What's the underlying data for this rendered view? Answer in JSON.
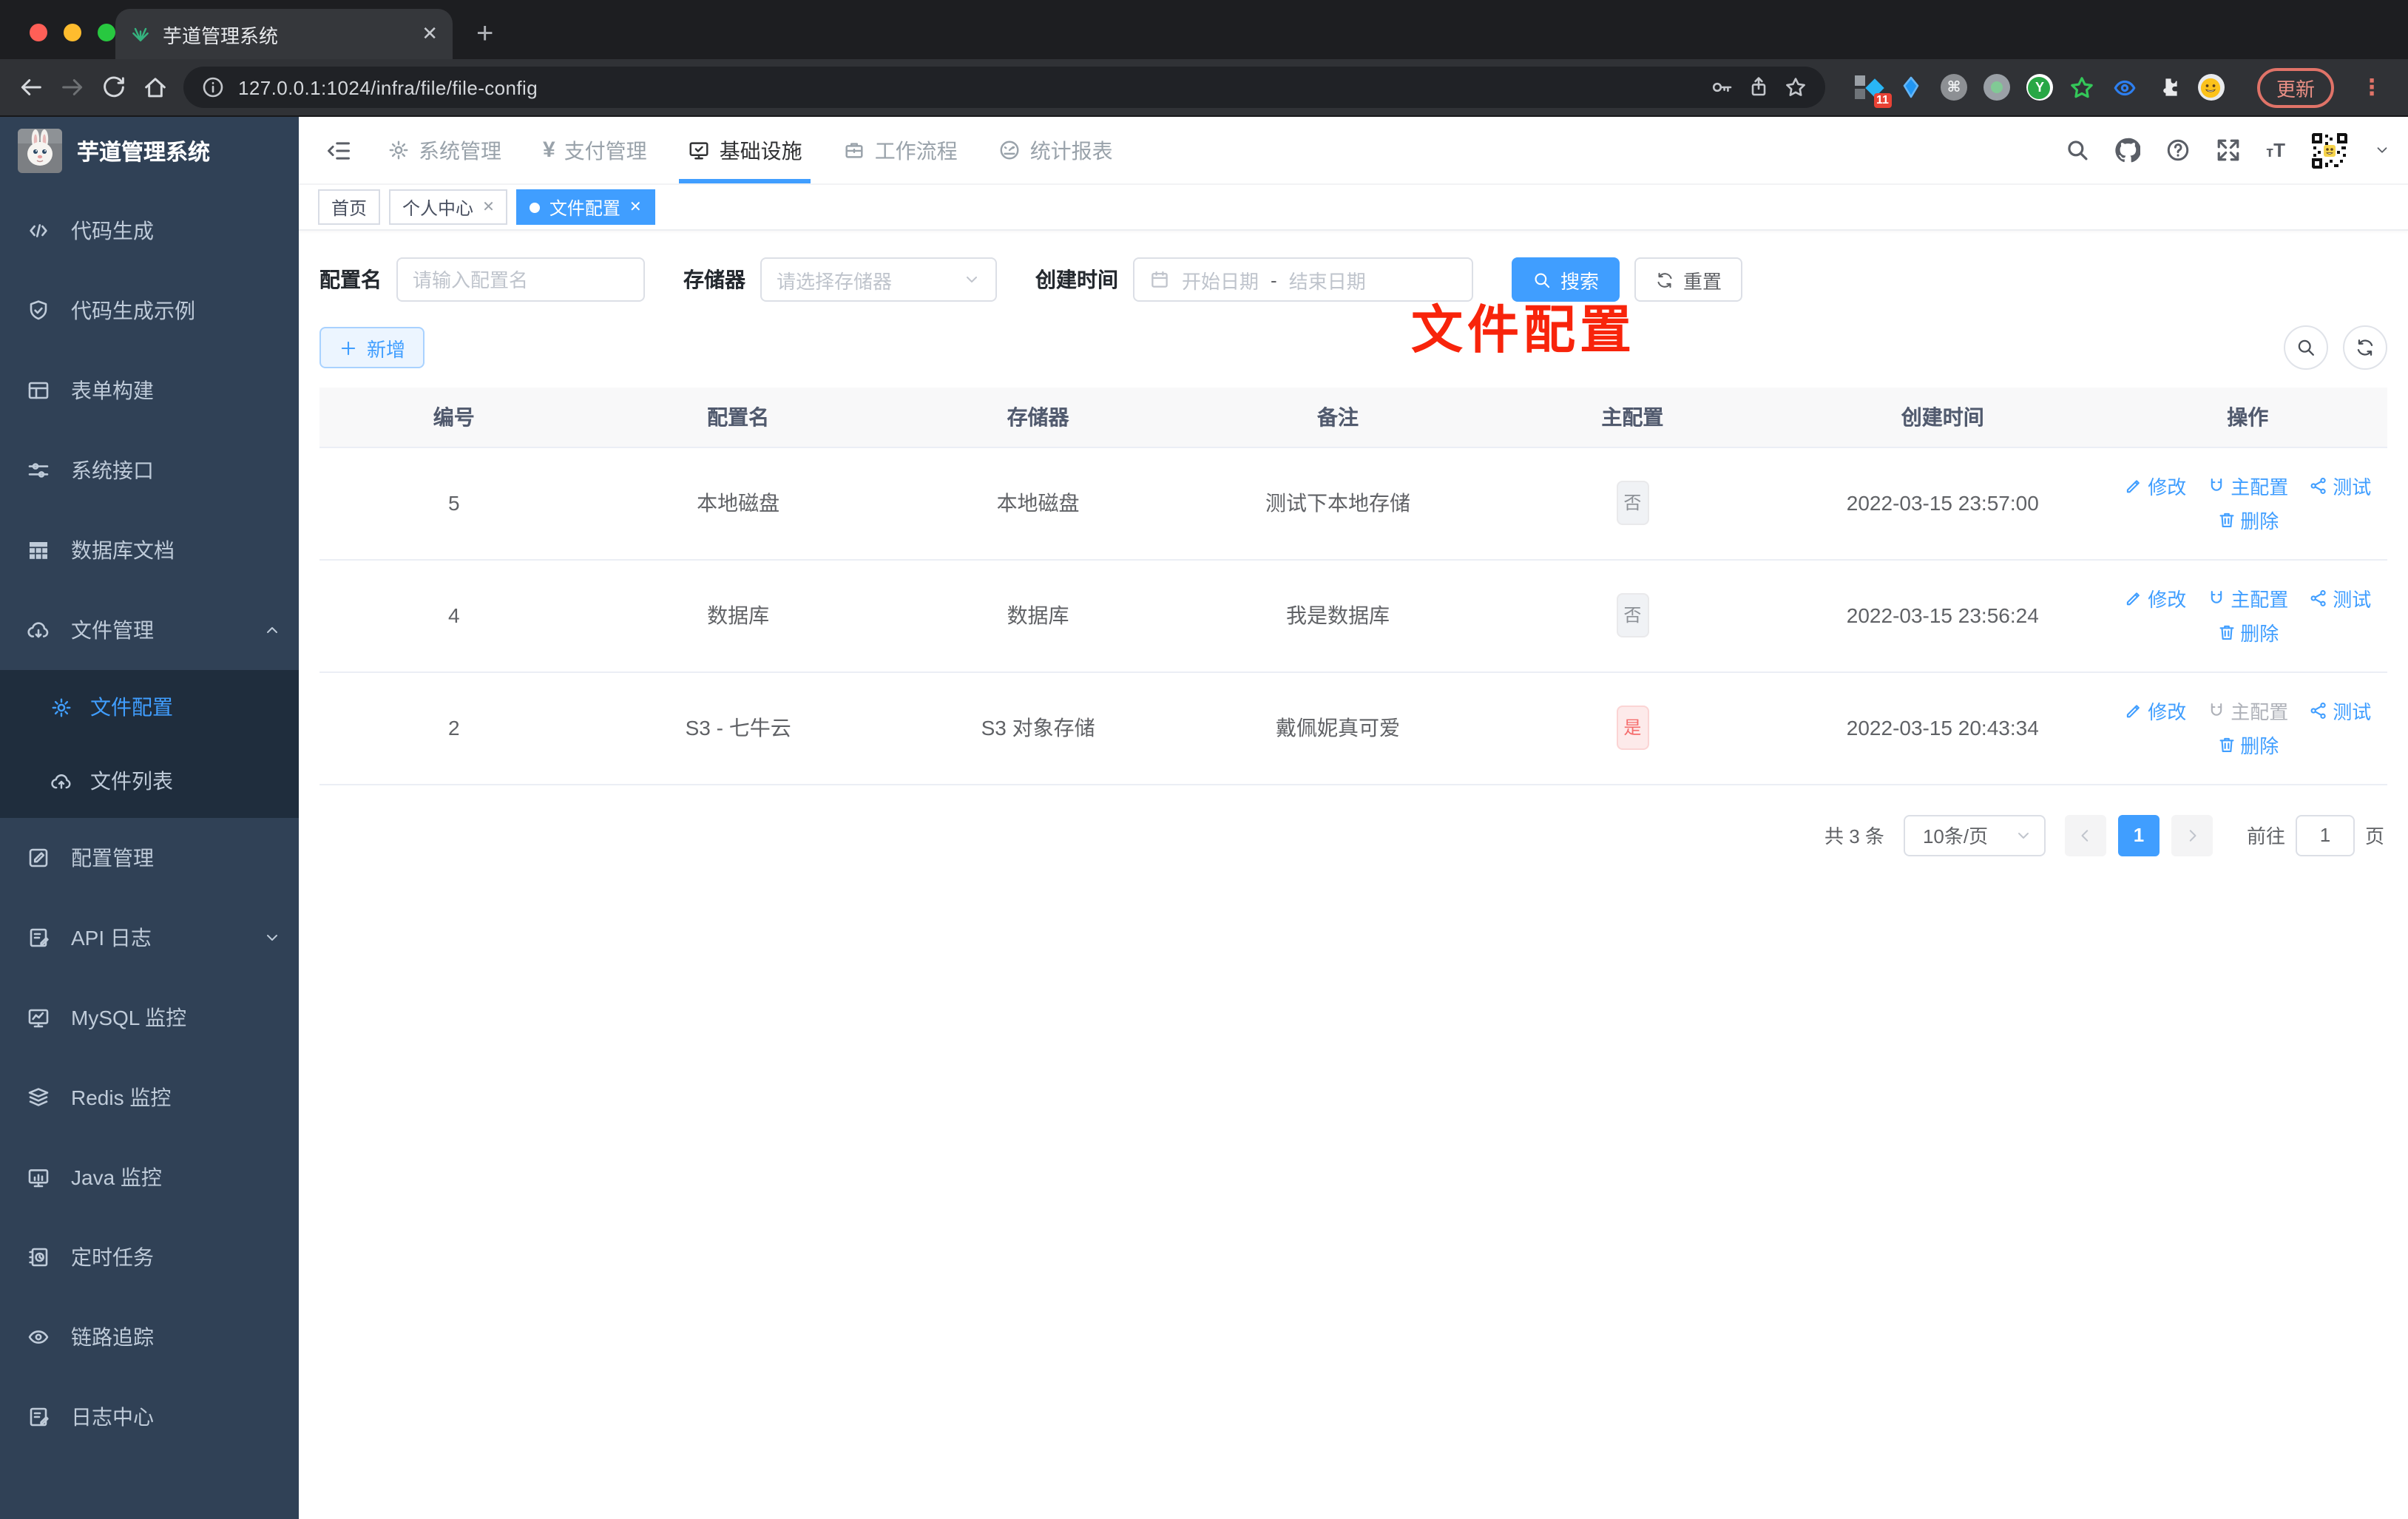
{
  "browser": {
    "tab_title": "芋道管理系统",
    "url": "127.0.0.1:1024/infra/file/file-config",
    "extension_badge": "11",
    "update_label": "更新"
  },
  "sidebar": {
    "logo_title": "芋道管理系统",
    "items": [
      {
        "label": "代码生成",
        "icon": "code-icon"
      },
      {
        "label": "代码生成示例",
        "icon": "shield-check-icon"
      },
      {
        "label": "表单构建",
        "icon": "form-icon"
      },
      {
        "label": "系统接口",
        "icon": "sliders-icon"
      },
      {
        "label": "数据库文档",
        "icon": "grid-icon"
      },
      {
        "label": "文件管理",
        "icon": "cloud-download-icon",
        "expanded": true,
        "children": [
          {
            "label": "文件配置",
            "icon": "gear-icon",
            "active": true
          },
          {
            "label": "文件列表",
            "icon": "cloud-upload-icon"
          }
        ]
      },
      {
        "label": "配置管理",
        "icon": "edit-square-icon"
      },
      {
        "label": "API 日志",
        "icon": "doc-edit-icon",
        "collapsed": true
      },
      {
        "label": "MySQL 监控",
        "icon": "monitor-chart-icon"
      },
      {
        "label": "Redis 监控",
        "icon": "layers-icon"
      },
      {
        "label": "Java 监控",
        "icon": "monitor-bars-icon"
      },
      {
        "label": "定时任务",
        "icon": "timer-icon"
      },
      {
        "label": "链路追踪",
        "icon": "eye-icon"
      },
      {
        "label": "日志中心",
        "icon": "doc-edit-icon"
      }
    ]
  },
  "topnav": {
    "items": [
      {
        "label": "系统管理",
        "icon": "gear-icon"
      },
      {
        "label": "支付管理",
        "icon": "yen-icon"
      },
      {
        "label": "基础设施",
        "icon": "monitor-check-icon",
        "active": true
      },
      {
        "label": "工作流程",
        "icon": "briefcase-icon"
      },
      {
        "label": "统计报表",
        "icon": "dashboard-icon"
      }
    ]
  },
  "tabs": [
    {
      "label": "首页"
    },
    {
      "label": "个人中心",
      "closable": true
    },
    {
      "label": "文件配置",
      "active": true,
      "closable": true
    }
  ],
  "annotation": "文件配置",
  "filters": {
    "name_label": "配置名",
    "name_placeholder": "请输入配置名",
    "storage_label": "存储器",
    "storage_placeholder": "请选择存储器",
    "date_label": "创建时间",
    "date_start_placeholder": "开始日期",
    "date_separator": "-",
    "date_end_placeholder": "结束日期",
    "search_label": "搜索",
    "reset_label": "重置"
  },
  "toolbar": {
    "add_label": "新增"
  },
  "table": {
    "columns": [
      "编号",
      "配置名",
      "存储器",
      "备注",
      "主配置",
      "创建时间",
      "操作"
    ],
    "ops": {
      "edit": "修改",
      "master": "主配置",
      "test": "测试",
      "delete": "删除"
    },
    "rows": [
      {
        "id": "5",
        "name": "本地磁盘",
        "storage": "本地磁盘",
        "remark": "测试下本地存储",
        "primary": "否",
        "primary_type": "info",
        "created": "2022-03-15 23:57:00"
      },
      {
        "id": "4",
        "name": "数据库",
        "storage": "数据库",
        "remark": "我是数据库",
        "primary": "否",
        "primary_type": "info",
        "created": "2022-03-15 23:56:24"
      },
      {
        "id": "2",
        "name": "S3 - 七牛云",
        "storage": "S3 对象存储",
        "remark": "戴佩妮真可爱",
        "primary": "是",
        "primary_type": "danger",
        "created": "2022-03-15 20:43:34"
      }
    ]
  },
  "pagination": {
    "total": "共 3 条",
    "page_size": "10条/页",
    "current_page": "1",
    "goto_label": "前往",
    "goto_value": "1",
    "goto_suffix": "页"
  },
  "colors": {
    "primary": "#409eff",
    "sidebar_bg": "#304156",
    "submenu_bg": "#1f2d3d",
    "danger": "#f56c6c",
    "annotation_red": "#f8240b"
  }
}
